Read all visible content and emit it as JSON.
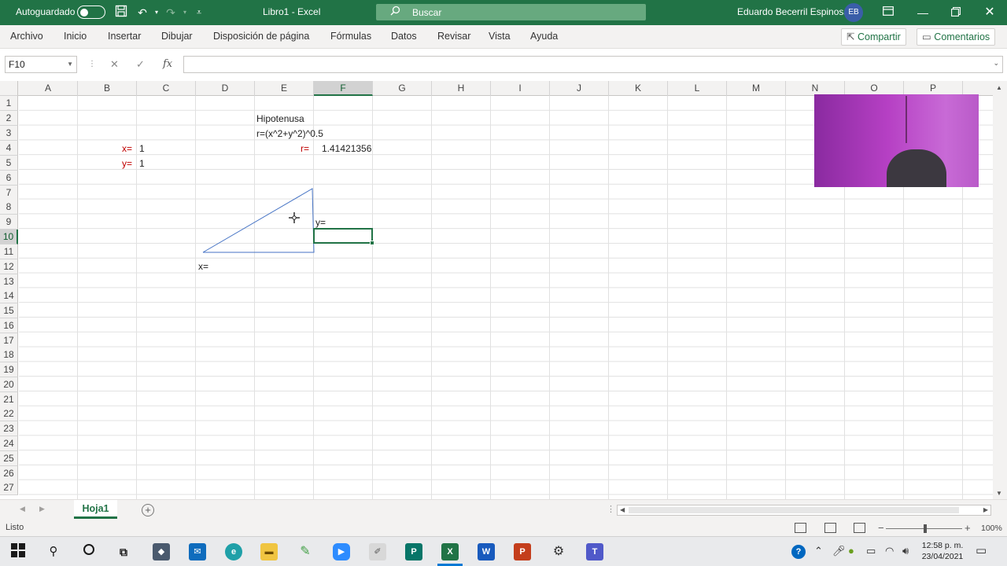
{
  "titlebar": {
    "autosave_label": "Autoguardado",
    "doc_title": "Libro1  -  Excel",
    "search_placeholder": "Buscar",
    "user_name": "Eduardo Becerril Espinosa",
    "user_initials": "EB",
    "colors": {
      "bar": "#217346"
    }
  },
  "menu": {
    "items": [
      "Archivo",
      "Inicio",
      "Insertar",
      "Dibujar",
      "Disposición de página",
      "Fórmulas",
      "Datos",
      "Revisar",
      "Vista",
      "Ayuda"
    ],
    "share_label": "Compartir",
    "comments_label": "Comentarios"
  },
  "formula_bar": {
    "name_box": "F10",
    "fx": "fx",
    "value": ""
  },
  "columns": [
    "A",
    "B",
    "C",
    "D",
    "E",
    "F",
    "G",
    "H",
    "I",
    "J",
    "K",
    "L",
    "M",
    "N",
    "O",
    "P"
  ],
  "rows": [
    "1",
    "2",
    "3",
    "4",
    "5",
    "6",
    "7",
    "8",
    "9",
    "10",
    "11",
    "12",
    "13",
    "14",
    "15",
    "16",
    "17",
    "18",
    "19",
    "20",
    "21",
    "22",
    "23",
    "24",
    "25",
    "26",
    "27"
  ],
  "selected": {
    "column": "F",
    "row": "10"
  },
  "cells": {
    "E2": "Hipotenusa",
    "E3": "r=(x^2+y^2)^0.5",
    "B4": "x=",
    "C4": "1",
    "B5": "y=",
    "C5": "1",
    "E4": "r=",
    "F4": "1.41421356"
  },
  "drawing": {
    "y_label": "y=",
    "x_label": "x="
  },
  "sheets": {
    "tabs": [
      "Hoja1"
    ]
  },
  "status": {
    "mode": "Listo",
    "zoom": "100%"
  },
  "taskbar": {
    "time": "12:58 p. m.",
    "date": "23/04/2021"
  }
}
